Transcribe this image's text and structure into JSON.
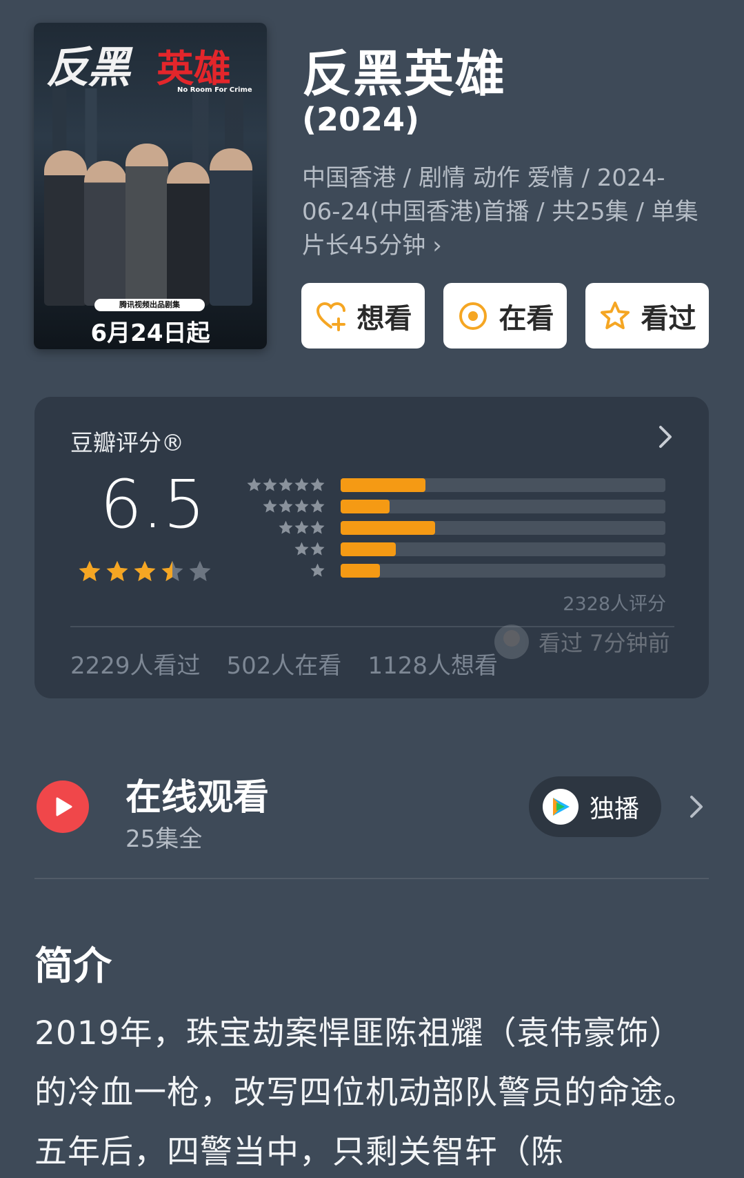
{
  "poster": {
    "title_part1": "反黑",
    "title_part2": "英雄",
    "english_title": "No Room For Crime",
    "produced_by": "腾讯视频出品剧集",
    "premiere": "6月24日起"
  },
  "title": "反黑英雄",
  "year": "(2024)",
  "meta": "中国香港 / 剧情 动作 爱情 / 2024-06-24(中国香港)首播 / 共25集 / 单集片长45分钟",
  "meta_chevron": "›",
  "actions": {
    "want": "想看",
    "watching": "在看",
    "watched": "看过"
  },
  "rating": {
    "label": "豆瓣评分®",
    "score": "6.5",
    "stars_value": 3.5,
    "distribution": [
      {
        "stars": 5,
        "fraction": 0.26
      },
      {
        "stars": 4,
        "fraction": 0.15
      },
      {
        "stars": 3,
        "fraction": 0.29
      },
      {
        "stars": 2,
        "fraction": 0.17
      },
      {
        "stars": 1,
        "fraction": 0.12
      }
    ],
    "count": "2328人评分",
    "activity": "看过  7分钟前",
    "stats": {
      "watched": "2229人看过",
      "watching": "502人在看",
      "want": "1128人想看"
    }
  },
  "online": {
    "title": "在线观看",
    "episodes": "25集全",
    "exclusive": "独播"
  },
  "synopsis": {
    "title": "简介",
    "text": "2019年，珠宝劫案悍匪陈祖耀（袁伟豪饰）的冷血一枪，改写四位机动部队警员的命途。五年后，四警当中，只剩关智轩（陈"
  },
  "colors": {
    "background": "#3e4a58",
    "card": "#2f3946",
    "accent": "#f59a14",
    "play": "#f0474a"
  }
}
